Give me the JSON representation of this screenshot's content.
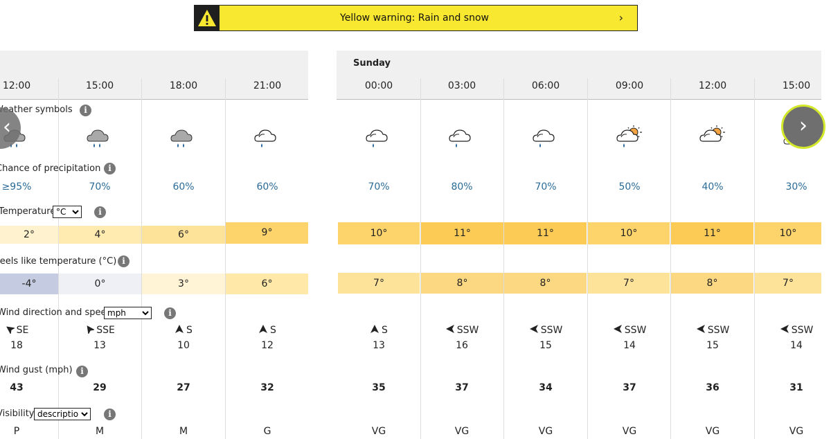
{
  "warning": {
    "text": "Yellow warning: Rain and snow",
    "icon": "warning-triangle-icon"
  },
  "day_label": "Sunday",
  "times_left": [
    "12:00",
    "15:00",
    "18:00",
    "21:00"
  ],
  "times_right": [
    "00:00",
    "03:00",
    "06:00",
    "09:00",
    "12:00",
    "15:00"
  ],
  "labels": {
    "weather_symbols": "Weather symbols",
    "precip": "Chance of precipitation",
    "temperature": "Temperature",
    "temp_unit": "°C",
    "feels_like": "Feels like temperature (°C)",
    "wind": "Wind direction and speed",
    "wind_unit": "mph",
    "gust": "Wind gust (mph)",
    "visibility": "Visibility",
    "visibility_mode": "description"
  },
  "symbols_left": [
    "heavy-rain-cloud",
    "rain-cloud",
    "rain-cloud",
    "light-rain-cloud"
  ],
  "symbols_right": [
    "light-rain-cloud",
    "light-rain-cloud",
    "light-rain-cloud",
    "sunny-intervals-rain",
    "sunny-intervals",
    "cloudy"
  ],
  "precip_left": [
    "≥95%",
    "70%",
    "60%",
    "60%"
  ],
  "precip_right": [
    "70%",
    "80%",
    "70%",
    "50%",
    "40%",
    "30%"
  ],
  "temp_left": [
    "2°",
    "4°",
    "6°",
    "9°"
  ],
  "temp_right": [
    "10°",
    "11°",
    "11°",
    "10°",
    "11°",
    "10°"
  ],
  "feels_left": [
    "-4°",
    "0°",
    "3°",
    "6°"
  ],
  "feels_right": [
    "7°",
    "8°",
    "8°",
    "7°",
    "8°",
    "7°"
  ],
  "wind_dir_left": [
    "SE",
    "SSE",
    "S",
    "S"
  ],
  "wind_dir_right": [
    "S",
    "SSW",
    "SSW",
    "SSW",
    "SSW",
    "SSW"
  ],
  "wind_speed_left": [
    "18",
    "13",
    "10",
    "12"
  ],
  "wind_speed_right": [
    "13",
    "16",
    "15",
    "14",
    "15",
    "14"
  ],
  "gust_left": [
    "43",
    "29",
    "27",
    "32"
  ],
  "gust_right": [
    "35",
    "37",
    "34",
    "37",
    "36",
    "31"
  ],
  "visibility_left": [
    "P",
    "M",
    "M",
    "G"
  ],
  "visibility_right": [
    "VG",
    "VG",
    "VG",
    "VG",
    "VG",
    "VG"
  ],
  "colors": {
    "temp_left": [
      "#fff3cf",
      "#ffeab0",
      "#fde29a",
      "#fdd36b"
    ],
    "temp_right": [
      "#fdd36b",
      "#fccb55",
      "#fccb55",
      "#fdd36b",
      "#fccb55",
      "#fdd36b"
    ],
    "feels_left": [
      "#c5cbe0",
      "#eef0f6",
      "#fff4d6",
      "#ffe8a8"
    ],
    "feels_right": [
      "#fde29a",
      "#fdd883",
      "#fdd883",
      "#fde29a",
      "#fdd883",
      "#fde29a"
    ],
    "precip_text": "#2a6b97",
    "banner": "#f9e830"
  },
  "nav": {
    "prev": "‹",
    "next": "›"
  }
}
